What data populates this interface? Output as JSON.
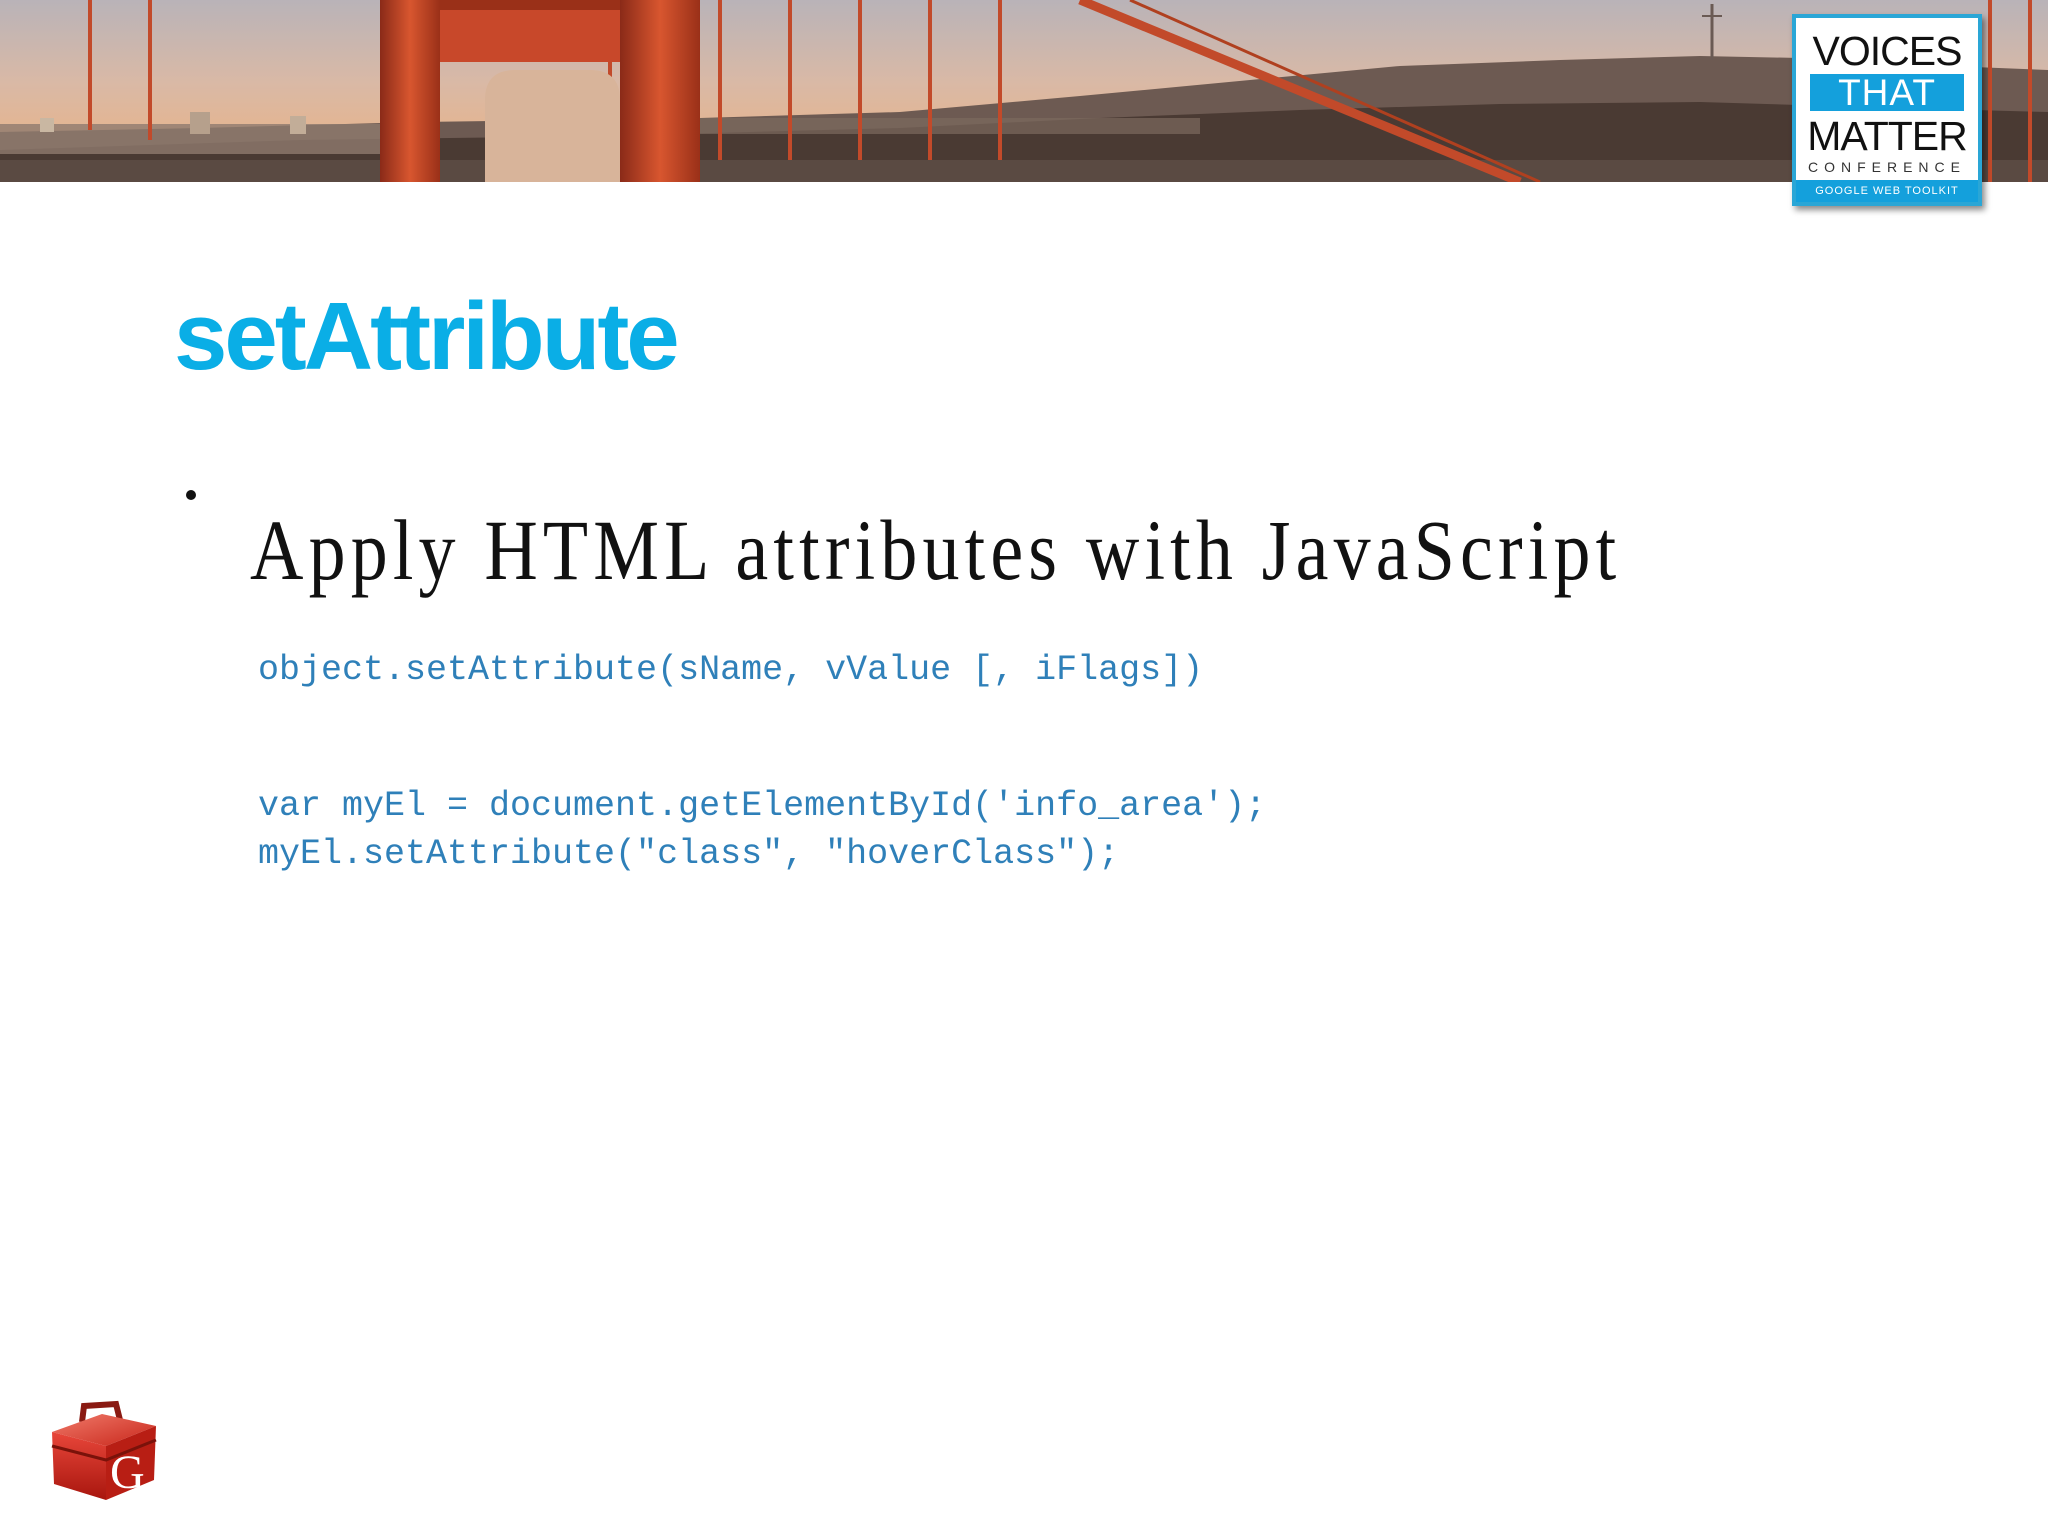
{
  "slide": {
    "title": "setAttribute",
    "bullet": "Apply HTML attributes with JavaScript",
    "code": {
      "signature": "object.setAttribute(sName, vValue [, iFlags])",
      "example_line_1": "var myEl = document.getElementById('info_area');",
      "example_line_2": "myEl.setAttribute(\"class\", \"hoverClass\");"
    }
  },
  "badge": {
    "line1": "VOICES",
    "line2": "THAT",
    "line3": "MATTER",
    "line4": "CONFERENCE",
    "line5": "GOOGLE WEB TOOLKIT"
  },
  "toolbox_logo": {
    "letter": "G",
    "icon": "gwt-toolbox-icon"
  },
  "colors": {
    "title": "#0aaee6",
    "code": "#2f80b9",
    "badge_accent": "#14a0dc",
    "bridge": "#c8482a"
  }
}
